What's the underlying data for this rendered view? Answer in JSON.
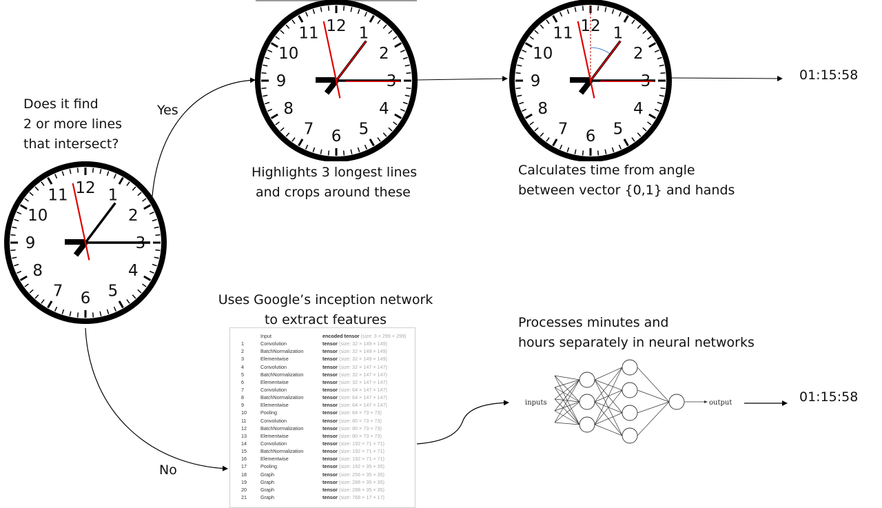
{
  "question": {
    "lines": [
      "Does it find",
      "2 or more lines",
      "that intersect?"
    ]
  },
  "branches": {
    "yes_label": "Yes",
    "no_label": "No"
  },
  "step_crop": {
    "lines": [
      "Highlights 3 longest lines",
      "and crops around these"
    ]
  },
  "step_angle": {
    "lines": [
      "Calculates time from angle",
      "between vector {0,1} and hands"
    ]
  },
  "step_inception": {
    "lines": [
      "Uses Google’s inception network",
      "to extract features"
    ]
  },
  "step_nn": {
    "lines": [
      "Processes minutes and",
      "hours separately in neural networks"
    ]
  },
  "results": {
    "top": "01:15:58",
    "bottom": "01:15:58"
  },
  "clock": {
    "numerals": [
      "12",
      "1",
      "2",
      "3",
      "4",
      "5",
      "6",
      "7",
      "8",
      "9",
      "10",
      "11"
    ],
    "hand_color": "#000000",
    "highlight_color": "#e00000",
    "angle_arc_color": "#3d7fd0"
  },
  "layer_table": {
    "header": {
      "name": "Input",
      "type": "encoded tensor",
      "size": "(size: 3 × 299 × 299)"
    },
    "rows": [
      {
        "idx": "1",
        "name": "Convolution",
        "type": "tensor",
        "size": "(size: 32 × 149 × 149)"
      },
      {
        "idx": "2",
        "name": "BatchNormalization",
        "type": "tensor",
        "size": "(size: 32 × 149 × 149)"
      },
      {
        "idx": "3",
        "name": "Elementwise",
        "type": "tensor",
        "size": "(size: 32 × 149 × 149)"
      },
      {
        "idx": "4",
        "name": "Convolution",
        "type": "tensor",
        "size": "(size: 32 × 147 × 147)"
      },
      {
        "idx": "5",
        "name": "BatchNormalization",
        "type": "tensor",
        "size": "(size: 32 × 147 × 147)"
      },
      {
        "idx": "6",
        "name": "Elementwise",
        "type": "tensor",
        "size": "(size: 32 × 147 × 147)"
      },
      {
        "idx": "7",
        "name": "Convolution",
        "type": "tensor",
        "size": "(size: 64 × 147 × 147)"
      },
      {
        "idx": "8",
        "name": "BatchNormalization",
        "type": "tensor",
        "size": "(size: 64 × 147 × 147)"
      },
      {
        "idx": "9",
        "name": "Elementwise",
        "type": "tensor",
        "size": "(size: 64 × 147 × 147)"
      },
      {
        "idx": "10",
        "name": "Pooling",
        "type": "tensor",
        "size": "(size: 64 × 73 × 73)"
      },
      {
        "idx": "11",
        "name": "Convolution",
        "type": "tensor",
        "size": "(size: 80 × 73 × 73)"
      },
      {
        "idx": "12",
        "name": "BatchNormalization",
        "type": "tensor",
        "size": "(size: 80 × 73 × 73)"
      },
      {
        "idx": "13",
        "name": "Elementwise",
        "type": "tensor",
        "size": "(size: 80 × 73 × 73)"
      },
      {
        "idx": "14",
        "name": "Convolution",
        "type": "tensor",
        "size": "(size: 192 × 71 × 71)"
      },
      {
        "idx": "15",
        "name": "BatchNormalization",
        "type": "tensor",
        "size": "(size: 192 × 71 × 71)"
      },
      {
        "idx": "16",
        "name": "Elementwise",
        "type": "tensor",
        "size": "(size: 192 × 71 × 71)"
      },
      {
        "idx": "17",
        "name": "Pooling",
        "type": "tensor",
        "size": "(size: 192 × 35 × 35)"
      },
      {
        "idx": "18",
        "name": "Graph",
        "type": "tensor",
        "size": "(size: 256 × 35 × 35)"
      },
      {
        "idx": "19",
        "name": "Graph",
        "type": "tensor",
        "size": "(size: 288 × 35 × 35)"
      },
      {
        "idx": "20",
        "name": "Graph",
        "type": "tensor",
        "size": "(size: 288 × 35 × 35)"
      },
      {
        "idx": "21",
        "name": "Graph",
        "type": "tensor",
        "size": "(size: 768 × 17 × 17)"
      }
    ]
  },
  "neural_net": {
    "input_label": "inputs",
    "output_label": "output",
    "layers": [
      3,
      4,
      1
    ]
  }
}
